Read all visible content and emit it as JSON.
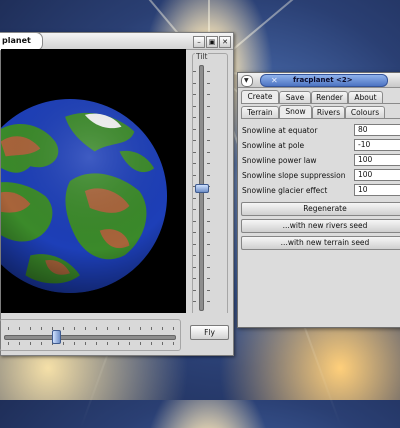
{
  "viewer": {
    "title": "planet",
    "buttons": [
      "–",
      "▣",
      "✕"
    ],
    "tilt_label": "Tilt",
    "tilt_level_percent": 50,
    "spin_level_percent": 30,
    "fly_label": "Fly"
  },
  "control": {
    "window_title": "fracplanet <2>",
    "menu_glyph": "▼",
    "close_glyph": "✕",
    "tabs_row1": [
      "Create",
      "Save",
      "Render",
      "About"
    ],
    "tabs_row2": [
      "Terrain",
      "Snow",
      "Rivers",
      "Colours"
    ],
    "active_tab_row1": "Create",
    "active_tab_row2": "Snow",
    "fields": [
      {
        "label": "Snowline at equator",
        "value": "80"
      },
      {
        "label": "Snowline at pole",
        "value": "-10"
      },
      {
        "label": "Snowline power law",
        "value": "100"
      },
      {
        "label": "Snowline slope suppression",
        "value": "100"
      },
      {
        "label": "Snowline glacier effect",
        "value": "10"
      }
    ],
    "regenerate_label": "Regenerate",
    "rivers_seed_label": "...with new rivers seed",
    "terrain_seed_label": "...with new terrain seed"
  },
  "colors": {
    "ocean": "#1d3fb8",
    "land": "#3b8a2a",
    "highland": "#a8643a",
    "snow": "#f3f3f3",
    "title_pill": "#4d74c2"
  }
}
